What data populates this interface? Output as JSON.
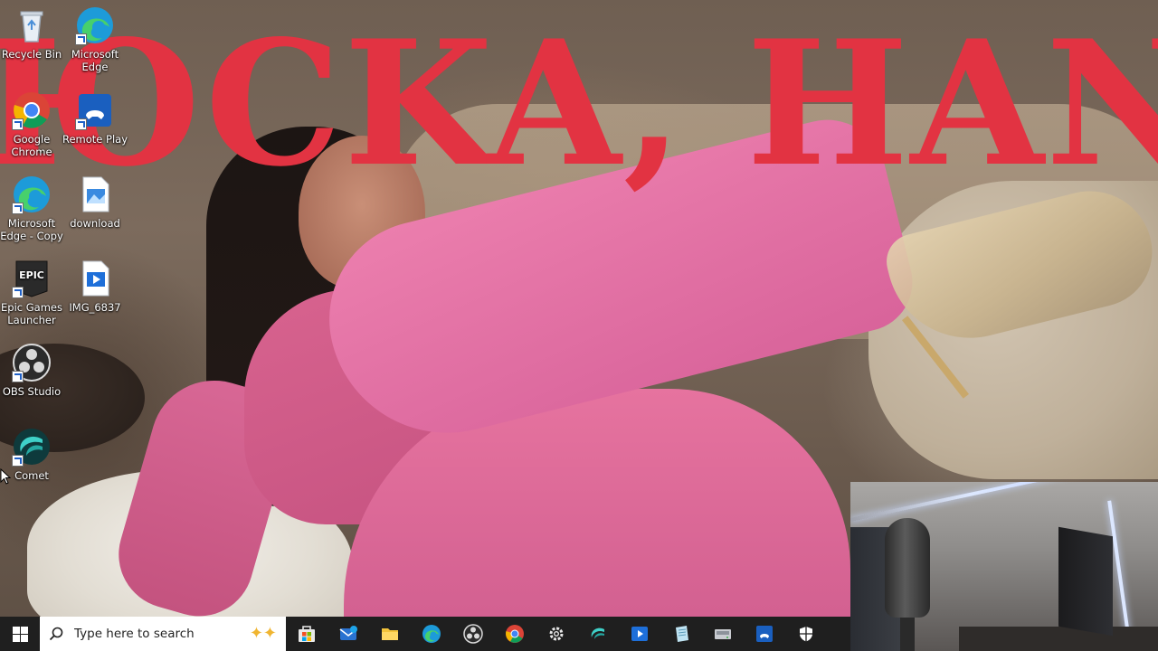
{
  "wallpaper": {
    "overlay_text": "ЮCKA, HANN"
  },
  "desktop_icons": [
    {
      "name": "recycle-bin",
      "label": "Recycle Bin",
      "icon": "recycle-bin-icon"
    },
    {
      "name": "microsoft-edge",
      "label": "Microsoft Edge",
      "icon": "edge-icon"
    },
    {
      "name": "google-chrome",
      "label": "Google Chrome",
      "icon": "chrome-icon"
    },
    {
      "name": "remote-play",
      "label": "Remote Play",
      "icon": "remote-play-icon"
    },
    {
      "name": "microsoft-edge-copy",
      "label": "Microsoft Edge - Copy",
      "icon": "edge-icon"
    },
    {
      "name": "download",
      "label": "download",
      "icon": "image-file-icon"
    },
    {
      "name": "epic-games-launcher",
      "label": "Epic Games Launcher",
      "icon": "epic-games-icon"
    },
    {
      "name": "img-6837",
      "label": "IMG_6837",
      "icon": "video-file-icon"
    },
    {
      "name": "obs-studio",
      "label": "OBS Studio",
      "icon": "obs-icon"
    },
    {
      "name": "comet",
      "label": "Comet",
      "icon": "comet-icon"
    }
  ],
  "epic_logo_text": "EPIC",
  "taskbar": {
    "search_placeholder": "Type here to search",
    "apps": [
      {
        "name": "taskbar-store",
        "icon": "store-icon"
      },
      {
        "name": "taskbar-mail",
        "icon": "mail-icon"
      },
      {
        "name": "taskbar-file-explorer",
        "icon": "folder-icon"
      },
      {
        "name": "taskbar-edge",
        "icon": "edge-icon"
      },
      {
        "name": "taskbar-obs",
        "icon": "obs-icon"
      },
      {
        "name": "taskbar-chrome",
        "icon": "chrome-icon"
      },
      {
        "name": "taskbar-settings",
        "icon": "gear-icon"
      },
      {
        "name": "taskbar-comet",
        "icon": "comet-icon"
      },
      {
        "name": "taskbar-media-player",
        "icon": "media-player-icon"
      },
      {
        "name": "taskbar-notepad",
        "icon": "notepad-icon"
      },
      {
        "name": "taskbar-drive",
        "icon": "drive-icon"
      },
      {
        "name": "taskbar-remote-play",
        "icon": "remote-play-icon"
      },
      {
        "name": "taskbar-security",
        "icon": "shield-icon"
      }
    ]
  },
  "colors": {
    "overlay_text": "#e23342",
    "taskbar": "#1f1f1f",
    "search_box": "#ffffff"
  }
}
